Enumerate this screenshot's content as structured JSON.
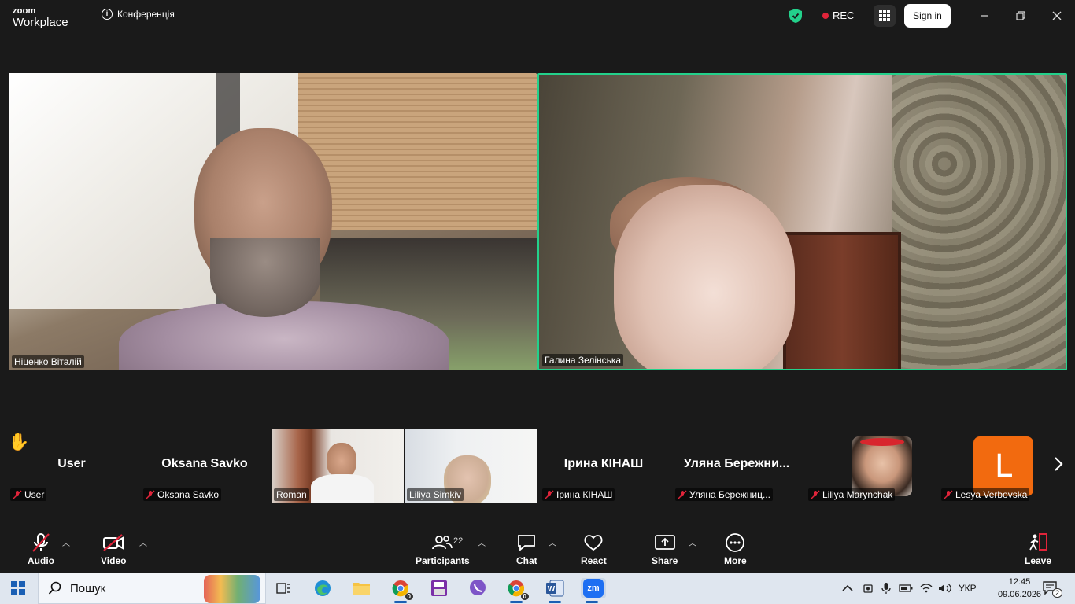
{
  "titlebar": {
    "logo_line1": "zoom",
    "logo_line2": "Workplace",
    "meeting_label": "Конференція",
    "rec_label": "REC",
    "signin_label": "Sign in"
  },
  "videos": {
    "main_left_name": "Ніценко Віталій",
    "main_right_name": "Галина Зелінська"
  },
  "strip": [
    {
      "big": "User",
      "label": "User"
    },
    {
      "big": "Oksana Savko",
      "label": "Oksana Savko"
    },
    {
      "label": "Roman"
    },
    {
      "label": "Liliya Simkiv"
    },
    {
      "big": "Ірина КІНАШ",
      "label": "Ірина КІНАШ"
    },
    {
      "big": "Уляна  Бережни...",
      "label": "Уляна Бережниц..."
    },
    {
      "label": "Liliya Marynchak"
    },
    {
      "avatar_letter": "L",
      "label": "Lesya Verbovska"
    }
  ],
  "toolbar": {
    "audio": "Audio",
    "video": "Video",
    "participants": "Participants",
    "participants_count": "22",
    "chat": "Chat",
    "react": "React",
    "share": "Share",
    "more": "More",
    "leave": "Leave"
  },
  "taskbar": {
    "search_label": "Пошук",
    "lang": "УКР",
    "time": "12:45",
    "date": "09.06.2026",
    "notif_count": "2",
    "chrome_badge_1": "0",
    "chrome_badge_2": "0",
    "zoom_label": "zm"
  },
  "colors": {
    "active_speaker": "#23d18b",
    "rec_dot": "#e0243a",
    "avatar_orange": "#f26a0f",
    "mic_off_red": "#e0243a"
  }
}
